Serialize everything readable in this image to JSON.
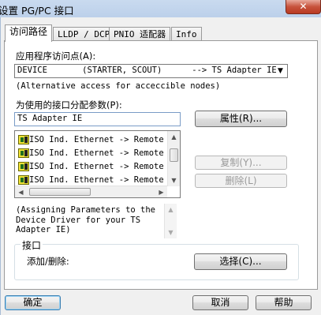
{
  "window": {
    "title": "设置 PG/PC 接口",
    "close_glyph": "✕"
  },
  "tabs": [
    {
      "label": "访问路径",
      "active": true
    },
    {
      "label": "LLDP / DCP",
      "active": false
    },
    {
      "label": "PNIO 适配器",
      "active": false
    },
    {
      "label": "Info",
      "active": false
    }
  ],
  "access_point": {
    "label": "应用程序访问点(A):",
    "value": "DEVICE       (STARTER, SCOUT)      --> TS Adapter IE",
    "dropdown_glyph": "▼",
    "hint": "(Alternative access for acceccible nodes)"
  },
  "interface": {
    "label": "为使用的接口分配参数(P):",
    "value": "TS Adapter IE",
    "items": [
      "ISO Ind. Ethernet -> Remote",
      "ISO Ind. Ethernet -> Remote",
      "ISO Ind. Ethernet -> Remote",
      "ISO Ind. Ethernet -> Remote"
    ],
    "description": "(Assigning Parameters to the Device Driver for your TS Adapter IE)",
    "scroll_up_glyph": "▲",
    "scroll_down_glyph": "▼",
    "scroll_left_glyph": "◀",
    "scroll_right_glyph": "▶"
  },
  "buttons": {
    "properties": "属性(R)...",
    "copy": "复制(Y)...",
    "delete": "删除(L)",
    "select": "选择(C)...",
    "ok": "确定",
    "cancel": "取消",
    "help": "帮助"
  },
  "group": {
    "title": "接口",
    "add_remove_label": "添加/删除:"
  },
  "colors": {
    "titlebar": "#c9daef",
    "close_button": "#c7533c",
    "default_button_border": "#3c7fb1"
  }
}
